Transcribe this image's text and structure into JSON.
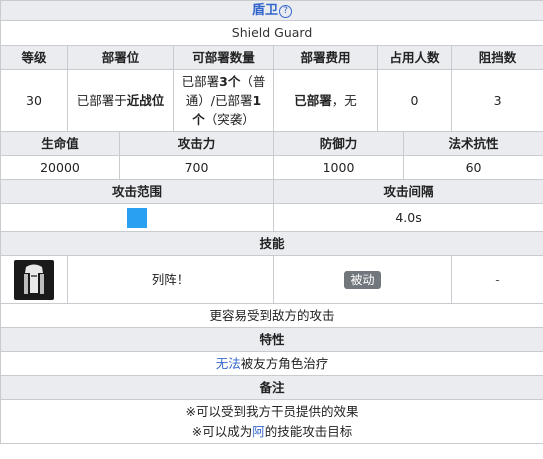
{
  "title": "盾卫",
  "subtitle": "Shield Guard",
  "stats1": {
    "headers": [
      "等级",
      "部署位",
      "可部署数量",
      "部署费用",
      "占用人数",
      "阻挡数"
    ],
    "level": "30",
    "position_prefix": "已部署于",
    "position_bold": "近战位",
    "deploy_p1": "已部署",
    "deploy_b1": "3个",
    "deploy_p2": "（普通）/已部署",
    "deploy_b2": "1个",
    "deploy_p3": "（突袭）",
    "cost_bold": "已部署",
    "cost_rest": "，无",
    "occupancy": "0",
    "block": "3"
  },
  "stats2": {
    "headers": [
      "生命值",
      "攻击力",
      "防御力",
      "法术抗性"
    ],
    "values": [
      "20000",
      "700",
      "1000",
      "60"
    ]
  },
  "attack": {
    "range_header": "攻击范围",
    "interval_header": "攻击间隔",
    "interval": "4.0s",
    "range_color": "#29a0f2"
  },
  "skill": {
    "header": "技能",
    "name": "列阵！",
    "type": "被动",
    "extra": "-",
    "icon": "shield-robot-icon",
    "description": "更容易受到敌方的攻击"
  },
  "traits": {
    "header": "特性",
    "link": "无法",
    "text": "被友方角色治疗"
  },
  "notes": {
    "header": "备注",
    "line1": "※可以受到我方干员提供的效果",
    "line2_prefix": "※可以成为",
    "line2_link": "阿",
    "line2_suffix": "的技能攻击目标"
  }
}
